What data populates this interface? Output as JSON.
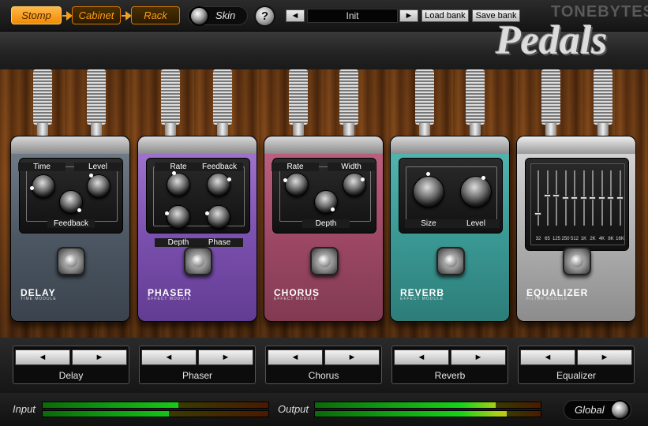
{
  "nav": {
    "stomp": "Stomp",
    "cabinet": "Cabinet",
    "rack": "Rack",
    "skin": "Skin",
    "help_glyph": "?"
  },
  "preset": {
    "prev": "◄",
    "name": "Init",
    "next": "►",
    "load_bank": "Load bank",
    "save_bank": "Save bank"
  },
  "brand": {
    "company": "TONEBYTES",
    "product": "Pedals"
  },
  "pedals": [
    {
      "name": "DELAY",
      "subtitle": "TIME MODULE",
      "knobs": [
        "Time",
        "Level",
        "Feedback"
      ]
    },
    {
      "name": "PHASER",
      "subtitle": "EFFECT MODULE",
      "knobs": [
        "Rate",
        "Feedback",
        "Depth",
        "Phase"
      ]
    },
    {
      "name": "CHORUS",
      "subtitle": "EFFECT MODULE",
      "knobs": [
        "Rate",
        "Width",
        "Depth"
      ]
    },
    {
      "name": "REVERB",
      "subtitle": "EFFECT MODULE",
      "knobs": [
        "Size",
        "Level"
      ]
    },
    {
      "name": "EQUALIZER",
      "subtitle": "FILTER MODULE",
      "bands": [
        "32",
        "65",
        "125",
        "250",
        "512",
        "1K",
        "2K",
        "4K",
        "8K",
        "16K"
      ],
      "band_levels": [
        0.2,
        0.55,
        0.55,
        0.5,
        0.5,
        0.5,
        0.5,
        0.5,
        0.5,
        0.5
      ]
    }
  ],
  "slots": [
    {
      "label": "Delay",
      "left": "◄",
      "right": "►"
    },
    {
      "label": "Phaser",
      "left": "◄",
      "right": "►"
    },
    {
      "label": "Chorus",
      "left": "◄",
      "right": "►"
    },
    {
      "label": "Reverb",
      "left": "◄",
      "right": "►"
    },
    {
      "label": "Equalizer",
      "left": "◄",
      "right": "►"
    }
  ],
  "meters": {
    "input_label": "Input",
    "output_label": "Output",
    "input_levels": [
      0.6,
      0.56
    ],
    "output_levels": [
      0.8,
      0.85
    ],
    "global_label": "Global"
  },
  "colors": {
    "accent": "#f08a00",
    "delay": "#5d6a78",
    "phaser": "#8a5fb8",
    "chorus": "#a8506c",
    "reverb": "#3b9c98",
    "equalizer": "#b5b5b5"
  }
}
